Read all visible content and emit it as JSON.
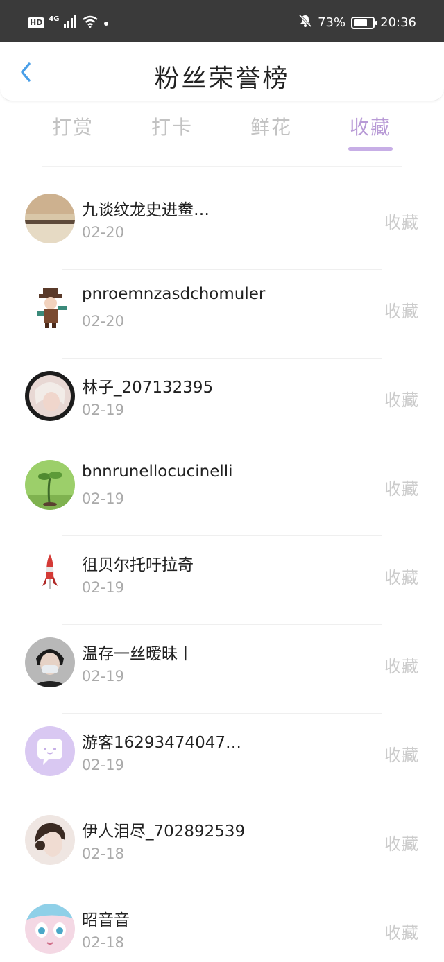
{
  "status_bar": {
    "hd": "HD",
    "network": "4G",
    "battery": "73%",
    "battery_level": 0.73,
    "time": "20:36"
  },
  "header": {
    "title": "粉丝荣誉榜",
    "back_icon": "chevron-left-icon",
    "accent_color": "#4a9fe8"
  },
  "tabs": [
    {
      "label": "打赏",
      "active": false
    },
    {
      "label": "打卡",
      "active": false
    },
    {
      "label": "鲜花",
      "active": false
    },
    {
      "label": "收藏",
      "active": true
    }
  ],
  "colors": {
    "tab_active": "#b89ad6",
    "tab_inactive": "#c2c2c2",
    "action_text": "#cccccc"
  },
  "fans": [
    {
      "name": "九谈纹龙史进鲞…",
      "date": "02-20",
      "action": "收藏"
    },
    {
      "name": "pnroemnzasdchomuler",
      "date": "02-20",
      "action": "收藏"
    },
    {
      "name": "林子_207132395",
      "date": "02-19",
      "action": "收藏"
    },
    {
      "name": "bnnrunellocucinelli",
      "date": "02-19",
      "action": "收藏"
    },
    {
      "name": "徂贝尔托吁拉奇",
      "date": "02-19",
      "action": "收藏"
    },
    {
      "name": "温存一丝暧昧丨",
      "date": "02-19",
      "action": "收藏"
    },
    {
      "name": "游客16293474047…",
      "date": "02-19",
      "action": "收藏"
    },
    {
      "name": "伊人泪尽_702892539",
      "date": "02-18",
      "action": "收藏"
    },
    {
      "name": "昭音音",
      "date": "02-18",
      "action": "收藏"
    }
  ]
}
